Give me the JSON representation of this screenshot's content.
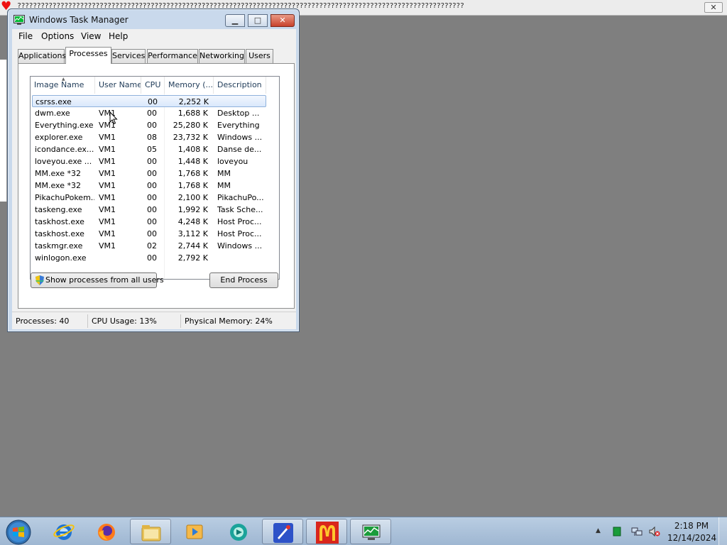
{
  "background_app": {
    "title": "????????????????????????????????????????????????????????????????????????????????????????????????????????????????????????????????????????????",
    "close_icon": "close-icon",
    "heart_icon": "heart-icon"
  },
  "window": {
    "title": "Windows Task Manager",
    "controls": {
      "minimize": "minimize-icon",
      "maximize": "maximize-icon",
      "close": "close-icon"
    }
  },
  "menu": [
    "File",
    "Options",
    "View",
    "Help"
  ],
  "tabs": [
    "Applications",
    "Processes",
    "Services",
    "Performance",
    "Networking",
    "Users"
  ],
  "active_tab": "Processes",
  "columns": [
    "Image Name",
    "User Name",
    "CPU",
    "Memory (...",
    "Description"
  ],
  "processes": [
    {
      "name": "csrss.exe",
      "user": "",
      "cpu": "00",
      "memory": "2,252 K",
      "description": ""
    },
    {
      "name": "dwm.exe",
      "user": "VM1",
      "cpu": "00",
      "memory": "1,688 K",
      "description": "Desktop ..."
    },
    {
      "name": "Everything.exe",
      "user": "VM1",
      "cpu": "00",
      "memory": "25,280 K",
      "description": "Everything"
    },
    {
      "name": "explorer.exe",
      "user": "VM1",
      "cpu": "08",
      "memory": "23,732 K",
      "description": "Windows ..."
    },
    {
      "name": "icondance.ex...",
      "user": "VM1",
      "cpu": "05",
      "memory": "1,408 K",
      "description": "Danse de..."
    },
    {
      "name": "loveyou.exe ...",
      "user": "VM1",
      "cpu": "00",
      "memory": "1,448 K",
      "description": "loveyou"
    },
    {
      "name": "MM.exe *32",
      "user": "VM1",
      "cpu": "00",
      "memory": "1,768 K",
      "description": "MM"
    },
    {
      "name": "MM.exe *32",
      "user": "VM1",
      "cpu": "00",
      "memory": "1,768 K",
      "description": "MM"
    },
    {
      "name": "PikachuPokem...",
      "user": "VM1",
      "cpu": "00",
      "memory": "2,100 K",
      "description": "PikachuPo..."
    },
    {
      "name": "taskeng.exe",
      "user": "VM1",
      "cpu": "00",
      "memory": "1,992 K",
      "description": "Task Sche..."
    },
    {
      "name": "taskhost.exe",
      "user": "VM1",
      "cpu": "00",
      "memory": "4,248 K",
      "description": "Host Proc..."
    },
    {
      "name": "taskhost.exe",
      "user": "VM1",
      "cpu": "00",
      "memory": "3,112 K",
      "description": "Host Proc..."
    },
    {
      "name": "taskmgr.exe",
      "user": "VM1",
      "cpu": "02",
      "memory": "2,744 K",
      "description": "Windows ..."
    },
    {
      "name": "winlogon.exe",
      "user": "",
      "cpu": "00",
      "memory": "2,792 K",
      "description": ""
    }
  ],
  "buttons": {
    "show_all": "Show processes from all users",
    "end_process": "End Process"
  },
  "status": {
    "processes": "Processes: 40",
    "cpu": "CPU Usage: 13%",
    "memory": "Physical Memory: 24%"
  },
  "taskbar": {
    "start": "windows-start-icon",
    "apps": [
      "internet-explorer-icon",
      "firefox-icon",
      "file-explorer-icon",
      "media-player-icon",
      "green-circle-app-icon",
      "rocket-app-icon",
      "mcdonalds-icon",
      "task-manager-icon"
    ],
    "tray": [
      "show-hidden-icons-icon",
      "green-app-tray-icon",
      "network-icon",
      "volume-muted-icon"
    ],
    "time": "2:18 PM",
    "date": "12/14/2024"
  },
  "colors": {
    "desktop": "#7f7f7f",
    "selection": "#d9e8fb",
    "close_button": "#c8412b"
  }
}
